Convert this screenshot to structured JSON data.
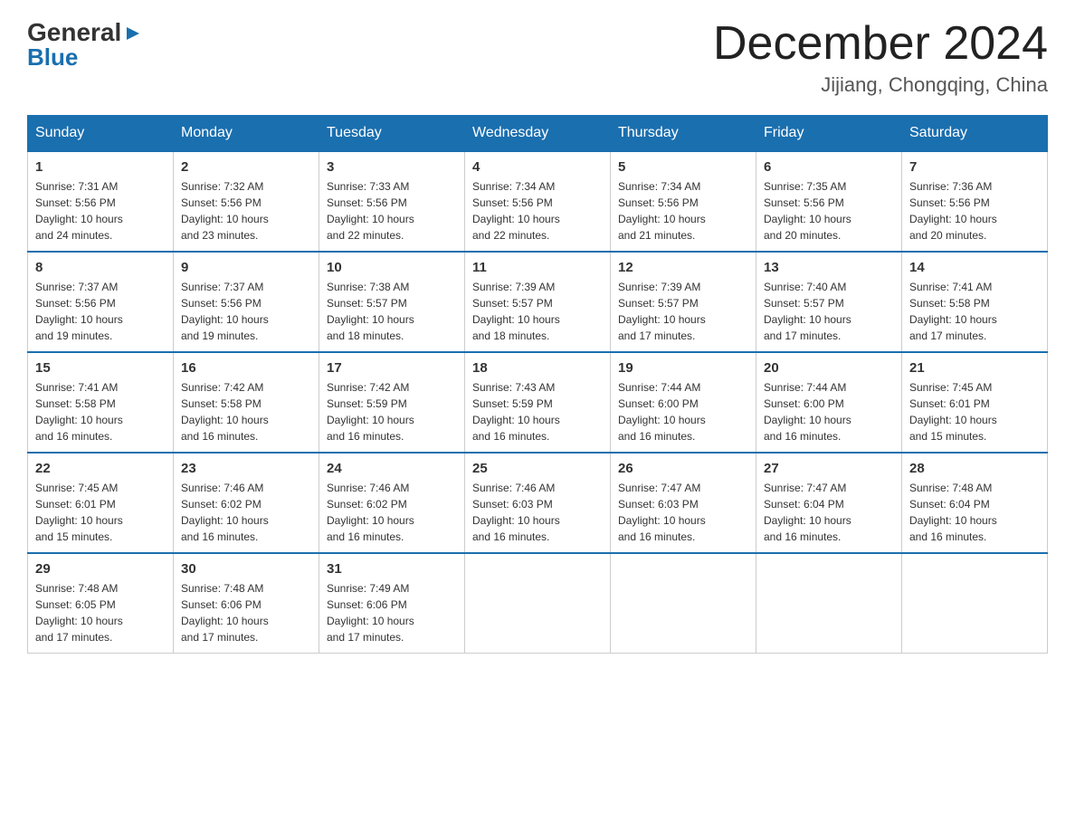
{
  "header": {
    "logo": {
      "line1_general": "General",
      "line1_arrow": "▶",
      "line2": "Blue"
    },
    "title": "December 2024",
    "subtitle": "Jijiang, Chongqing, China"
  },
  "calendar": {
    "days_of_week": [
      "Sunday",
      "Monday",
      "Tuesday",
      "Wednesday",
      "Thursday",
      "Friday",
      "Saturday"
    ],
    "weeks": [
      [
        {
          "day": "1",
          "sunrise": "7:31 AM",
          "sunset": "5:56 PM",
          "daylight": "10 hours and 24 minutes."
        },
        {
          "day": "2",
          "sunrise": "7:32 AM",
          "sunset": "5:56 PM",
          "daylight": "10 hours and 23 minutes."
        },
        {
          "day": "3",
          "sunrise": "7:33 AM",
          "sunset": "5:56 PM",
          "daylight": "10 hours and 22 minutes."
        },
        {
          "day": "4",
          "sunrise": "7:34 AM",
          "sunset": "5:56 PM",
          "daylight": "10 hours and 22 minutes."
        },
        {
          "day": "5",
          "sunrise": "7:34 AM",
          "sunset": "5:56 PM",
          "daylight": "10 hours and 21 minutes."
        },
        {
          "day": "6",
          "sunrise": "7:35 AM",
          "sunset": "5:56 PM",
          "daylight": "10 hours and 20 minutes."
        },
        {
          "day": "7",
          "sunrise": "7:36 AM",
          "sunset": "5:56 PM",
          "daylight": "10 hours and 20 minutes."
        }
      ],
      [
        {
          "day": "8",
          "sunrise": "7:37 AM",
          "sunset": "5:56 PM",
          "daylight": "10 hours and 19 minutes."
        },
        {
          "day": "9",
          "sunrise": "7:37 AM",
          "sunset": "5:56 PM",
          "daylight": "10 hours and 19 minutes."
        },
        {
          "day": "10",
          "sunrise": "7:38 AM",
          "sunset": "5:57 PM",
          "daylight": "10 hours and 18 minutes."
        },
        {
          "day": "11",
          "sunrise": "7:39 AM",
          "sunset": "5:57 PM",
          "daylight": "10 hours and 18 minutes."
        },
        {
          "day": "12",
          "sunrise": "7:39 AM",
          "sunset": "5:57 PM",
          "daylight": "10 hours and 17 minutes."
        },
        {
          "day": "13",
          "sunrise": "7:40 AM",
          "sunset": "5:57 PM",
          "daylight": "10 hours and 17 minutes."
        },
        {
          "day": "14",
          "sunrise": "7:41 AM",
          "sunset": "5:58 PM",
          "daylight": "10 hours and 17 minutes."
        }
      ],
      [
        {
          "day": "15",
          "sunrise": "7:41 AM",
          "sunset": "5:58 PM",
          "daylight": "10 hours and 16 minutes."
        },
        {
          "day": "16",
          "sunrise": "7:42 AM",
          "sunset": "5:58 PM",
          "daylight": "10 hours and 16 minutes."
        },
        {
          "day": "17",
          "sunrise": "7:42 AM",
          "sunset": "5:59 PM",
          "daylight": "10 hours and 16 minutes."
        },
        {
          "day": "18",
          "sunrise": "7:43 AM",
          "sunset": "5:59 PM",
          "daylight": "10 hours and 16 minutes."
        },
        {
          "day": "19",
          "sunrise": "7:44 AM",
          "sunset": "6:00 PM",
          "daylight": "10 hours and 16 minutes."
        },
        {
          "day": "20",
          "sunrise": "7:44 AM",
          "sunset": "6:00 PM",
          "daylight": "10 hours and 16 minutes."
        },
        {
          "day": "21",
          "sunrise": "7:45 AM",
          "sunset": "6:01 PM",
          "daylight": "10 hours and 15 minutes."
        }
      ],
      [
        {
          "day": "22",
          "sunrise": "7:45 AM",
          "sunset": "6:01 PM",
          "daylight": "10 hours and 15 minutes."
        },
        {
          "day": "23",
          "sunrise": "7:46 AM",
          "sunset": "6:02 PM",
          "daylight": "10 hours and 16 minutes."
        },
        {
          "day": "24",
          "sunrise": "7:46 AM",
          "sunset": "6:02 PM",
          "daylight": "10 hours and 16 minutes."
        },
        {
          "day": "25",
          "sunrise": "7:46 AM",
          "sunset": "6:03 PM",
          "daylight": "10 hours and 16 minutes."
        },
        {
          "day": "26",
          "sunrise": "7:47 AM",
          "sunset": "6:03 PM",
          "daylight": "10 hours and 16 minutes."
        },
        {
          "day": "27",
          "sunrise": "7:47 AM",
          "sunset": "6:04 PM",
          "daylight": "10 hours and 16 minutes."
        },
        {
          "day": "28",
          "sunrise": "7:48 AM",
          "sunset": "6:04 PM",
          "daylight": "10 hours and 16 minutes."
        }
      ],
      [
        {
          "day": "29",
          "sunrise": "7:48 AM",
          "sunset": "6:05 PM",
          "daylight": "10 hours and 17 minutes."
        },
        {
          "day": "30",
          "sunrise": "7:48 AM",
          "sunset": "6:06 PM",
          "daylight": "10 hours and 17 minutes."
        },
        {
          "day": "31",
          "sunrise": "7:49 AM",
          "sunset": "6:06 PM",
          "daylight": "10 hours and 17 minutes."
        },
        null,
        null,
        null,
        null
      ]
    ],
    "labels": {
      "sunrise": "Sunrise:",
      "sunset": "Sunset:",
      "daylight": "Daylight:"
    }
  }
}
